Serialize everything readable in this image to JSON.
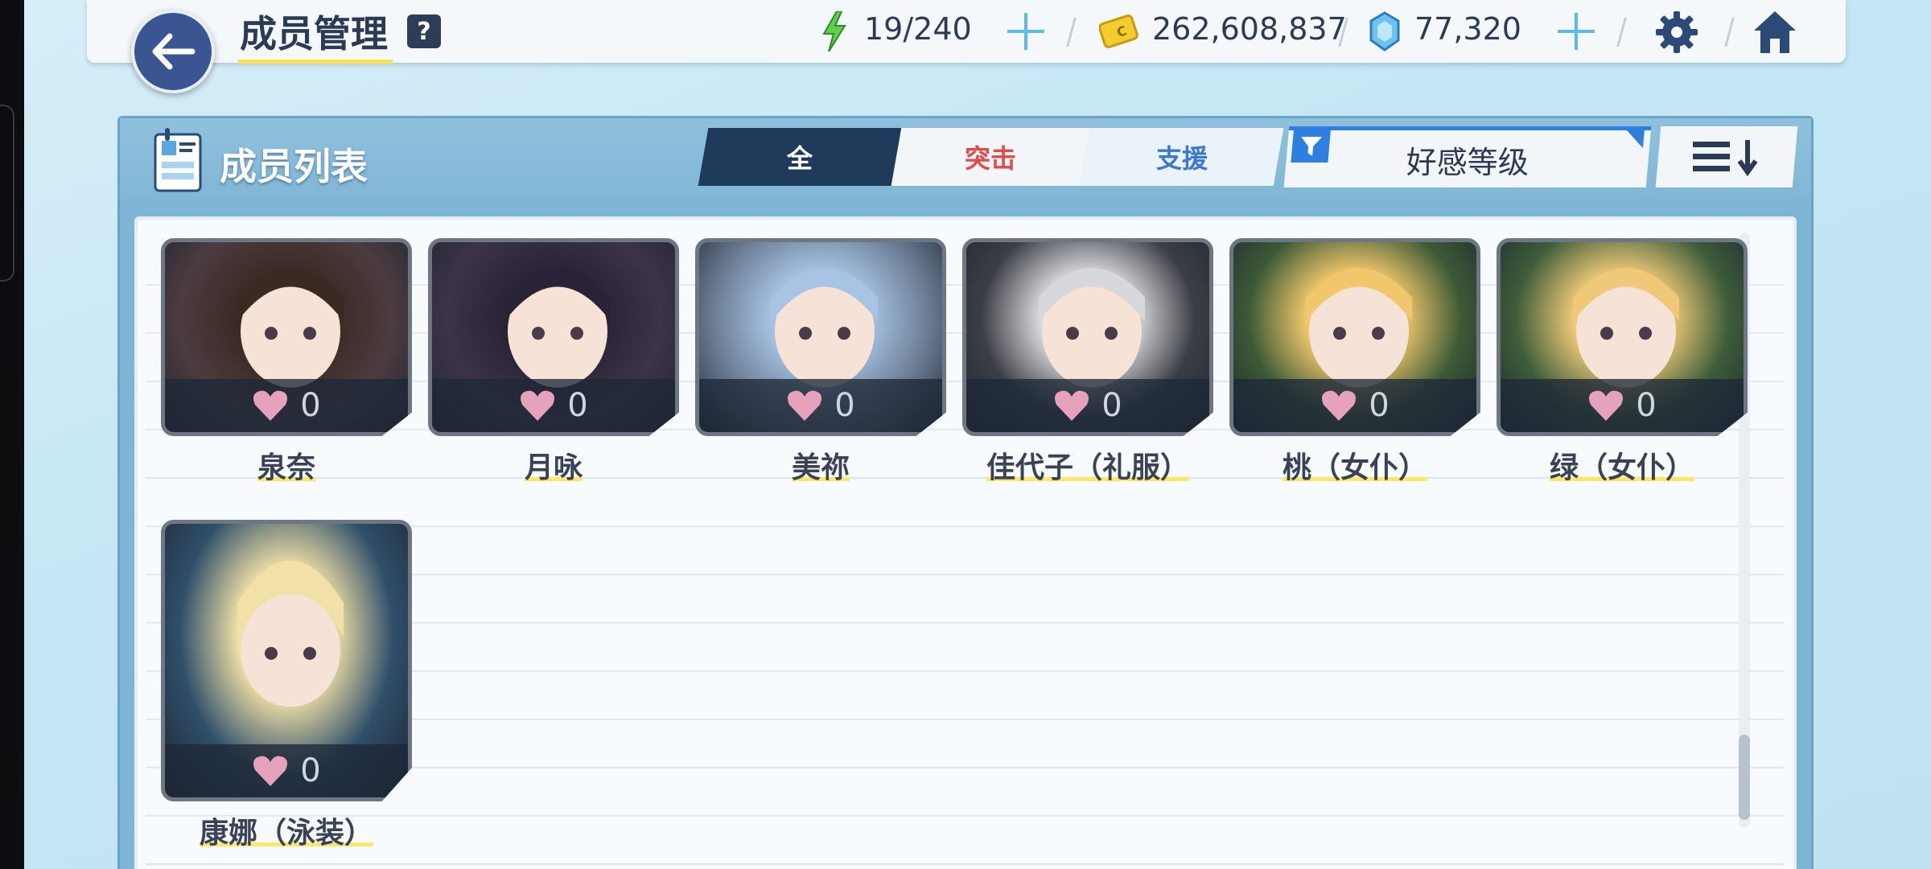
{
  "header": {
    "title": "成员管理",
    "help_label": "?",
    "ap": "19/240",
    "credits": "262,608,837",
    "gems": "77,320"
  },
  "panel": {
    "title": "成员列表",
    "tabs": [
      {
        "label": "全",
        "color": "#ffffff"
      },
      {
        "label": "突击",
        "color": "#e24a4a"
      },
      {
        "label": "支援",
        "color": "#3a78d6"
      }
    ],
    "filter_label": "好感等级"
  },
  "members": [
    {
      "name": "泉奈",
      "affection": "0",
      "hair": "#3a2a24",
      "bg": "#4b3c40"
    },
    {
      "name": "月咏",
      "affection": "0",
      "hair": "#2a2236",
      "bg": "#3c3446"
    },
    {
      "name": "美祢",
      "affection": "0",
      "hair": "#a7c4e4",
      "bg": "#6c7e95"
    },
    {
      "name": "佳代子（礼服）",
      "affection": "0",
      "hair": "#d8d8dc",
      "bg": "#3b3f45"
    },
    {
      "name": "桃（女仆）",
      "affection": "0",
      "hair": "#f2c76c",
      "bg": "#3c5a36"
    },
    {
      "name": "绿（女仆）",
      "affection": "0",
      "hair": "#efc878",
      "bg": "#3d5d3a"
    },
    {
      "name": "康娜（泳装）",
      "affection": "0",
      "hair": "#f2e1a6",
      "bg": "#2f4f6a"
    }
  ]
}
